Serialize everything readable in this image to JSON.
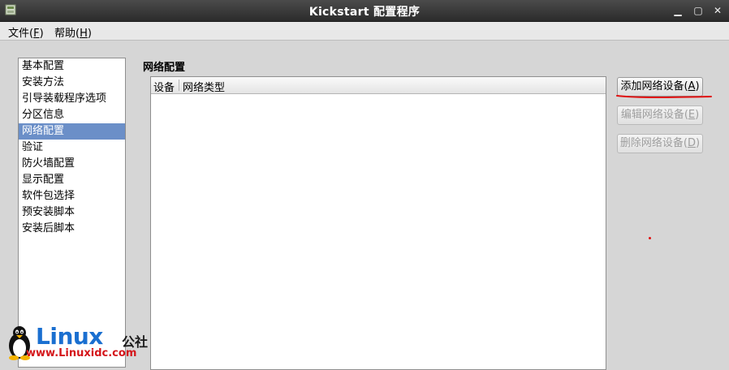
{
  "window": {
    "title": "Kickstart 配置程序",
    "minimize_glyph": "▁",
    "maximize_glyph": "▢",
    "close_glyph": "✕"
  },
  "menu": {
    "file": {
      "label": "文件(",
      "mnemonic": "F",
      "suffix": ")"
    },
    "help": {
      "label": "帮助(",
      "mnemonic": "H",
      "suffix": ")"
    }
  },
  "sidebar": {
    "items": [
      {
        "label": "基本配置"
      },
      {
        "label": "安装方法"
      },
      {
        "label": "引导装载程序选项"
      },
      {
        "label": "分区信息"
      },
      {
        "label": "网络配置"
      },
      {
        "label": "验证"
      },
      {
        "label": "防火墙配置"
      },
      {
        "label": "显示配置"
      },
      {
        "label": "软件包选择"
      },
      {
        "label": "预安装脚本"
      },
      {
        "label": "安装后脚本"
      }
    ],
    "selected_index": 4
  },
  "main": {
    "section_label": "网络配置",
    "table": {
      "columns": [
        "设备",
        "网络类型"
      ],
      "rows": []
    },
    "buttons": {
      "add": {
        "label": "添加网络设备(",
        "mnemonic": "A",
        "suffix": ")"
      },
      "edit": {
        "label": "编辑网络设备(",
        "mnemonic": "E",
        "suffix": ")"
      },
      "delete": {
        "label": "删除网络设备(",
        "mnemonic": "D",
        "suffix": ")"
      }
    }
  },
  "watermark": {
    "logo": "Linux",
    "logo_suffix": "公社",
    "url": "www.Linuxidc.com"
  },
  "colors": {
    "selection": "#6b8fc8",
    "annotation_red": "#e01010",
    "watermark_blue": "#1a6fd0",
    "watermark_red": "#d4151a"
  }
}
